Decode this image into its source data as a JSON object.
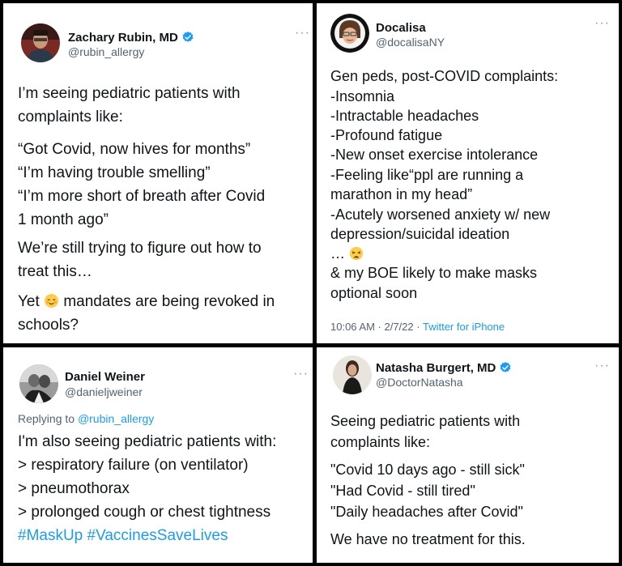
{
  "tweets": [
    {
      "author": "Zachary Rubin, MD",
      "handle": "@rubin_allergy",
      "verified": true,
      "lines": [
        "I’m seeing pediatric patients with",
        "complaints like:",
        "“Got Covid, now hives for months”",
        "“I’m having trouble smelling”",
        "“I’m more short of breath after Covid",
        "1 month ago”",
        "We’re still trying to figure out how to",
        "treat this…",
        "Yet",
        "mandates are being revoked in",
        "schools?"
      ]
    },
    {
      "author": "Docalisa",
      "handle": "@docalisaNY",
      "verified": false,
      "lines": [
        "Gen peds, post-COVID complaints:",
        "-Insomnia",
        "-Intractable headaches",
        "-Profound fatigue",
        "-New onset exercise intolerance",
        "-Feeling like“ppl are running a",
        "marathon in my head”",
        "-Acutely worsened anxiety w/ new",
        "depression/suicidal ideation",
        "…",
        "& my BOE likely to make masks",
        "optional soon"
      ],
      "timestamp": "10:06 AM · 2/7/22 ·",
      "source": "Twitter for iPhone"
    },
    {
      "author": "Daniel Weiner",
      "handle": "@danieljweiner",
      "verified": false,
      "replying_prefix": "Replying to",
      "replying_to": "@rubin_allergy",
      "lines": [
        "I'm also seeing pediatric patients with:",
        "> respiratory failure (on ventilator)",
        "> pneumothorax",
        "> prolonged cough or chest tightness"
      ],
      "hashtags": "#MaskUp #VaccinesSaveLives"
    },
    {
      "author": "Natasha Burgert, MD",
      "handle": "@DoctorNatasha",
      "verified": true,
      "lines": [
        "Seeing pediatric patients with",
        "complaints like:",
        "\"Covid 10 days ago - still sick\"",
        "\"Had Covid - still tired\"",
        "\"Daily headaches after Covid\"",
        "We have no treatment for this."
      ]
    }
  ],
  "more_icon_glyph": "···",
  "colors": {
    "link": "#1d9bf0",
    "secondary": "#536471",
    "verified": "#1d9bf0"
  }
}
